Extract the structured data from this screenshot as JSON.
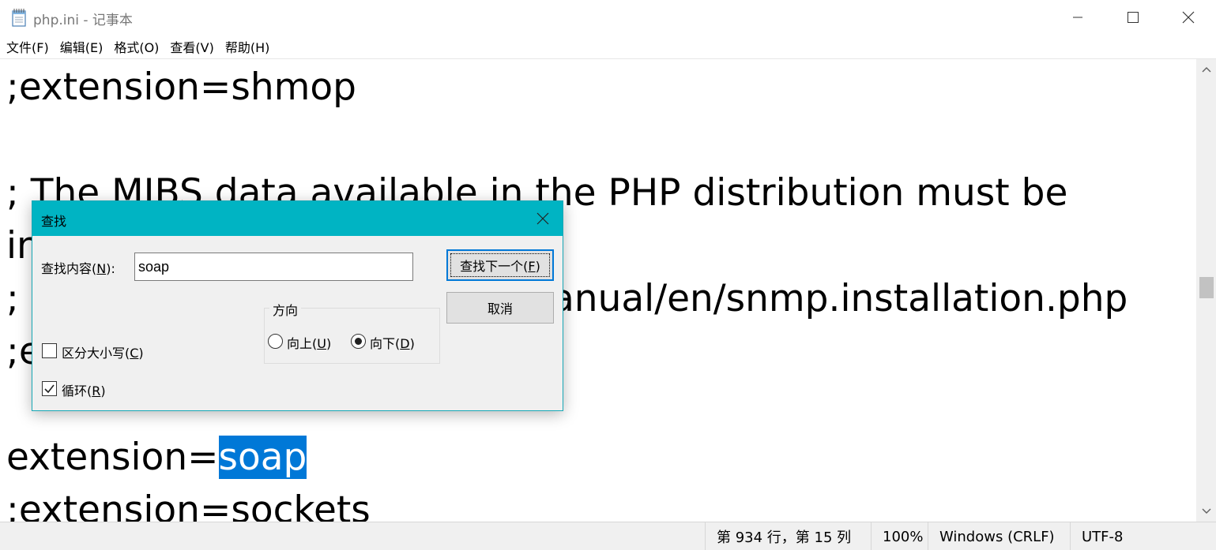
{
  "window": {
    "title": "php.ini - 记事本",
    "icon": "notepad-icon"
  },
  "menu": [
    {
      "label": "文件(",
      "key": "F",
      "end": ")"
    },
    {
      "label": "编辑(",
      "key": "E",
      "end": ")"
    },
    {
      "label": "格式(",
      "key": "O",
      "end": ")"
    },
    {
      "label": "查看(",
      "key": "V",
      "end": ")"
    },
    {
      "label": "帮助(",
      "key": "H",
      "end": ")"
    }
  ],
  "editor": {
    "lines": [
      ";extension=shmop",
      "",
      "; The MIBS data available in the PHP distribution must be",
      "in",
      ";",
      ";e",
      "",
      "extension=",
      ";extension=sockets"
    ],
    "line5_tail": "anual/en/snmp.installation.php",
    "selected_text": "soap",
    "selection_color": "#0078d7"
  },
  "status": {
    "position": "第 934 行，第 15 列",
    "zoom": "100%",
    "line_ending": "Windows (CRLF)",
    "encoding": "UTF-8"
  },
  "find_dialog": {
    "title": "查找",
    "find_label_pre": "查找内容(",
    "find_label_key": "N",
    "find_label_post": "):",
    "find_value": "soap",
    "find_next_pre": "查找下一个(",
    "find_next_key": "F",
    "find_next_post": ")",
    "cancel_label": "取消",
    "direction_label": "方向",
    "up_pre": "向上(",
    "up_key": "U",
    "up_post": ")",
    "down_pre": "向下(",
    "down_key": "D",
    "down_post": ")",
    "direction_selected": "down",
    "match_case_pre": "区分大小写(",
    "match_case_key": "C",
    "match_case_post": ")",
    "match_case_checked": false,
    "wrap_pre": "循环(",
    "wrap_key": "R",
    "wrap_post": ")",
    "wrap_checked": true,
    "title_bar_color": "#00b4c3"
  }
}
